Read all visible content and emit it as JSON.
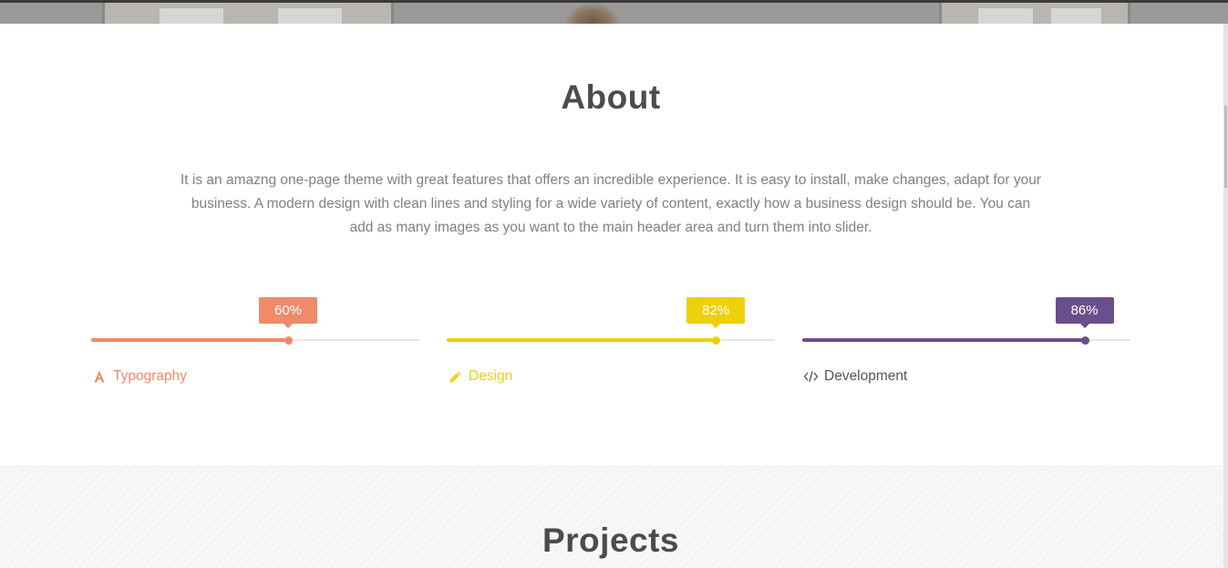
{
  "about": {
    "title": "About",
    "text": "It is an amazng one-page theme with great features that offers an incredible experience. It is easy to install, make changes, adapt for your business. A modern design with clean lines and styling for a wide variety of content, exactly how a business design should be. You can add as many images as you want to the main header area and turn them into slider."
  },
  "skills": [
    {
      "label": "Typography",
      "percent_label": "60%",
      "value": 60,
      "color": "#ef8a6b",
      "icon": "typography-icon"
    },
    {
      "label": "Design",
      "percent_label": "82%",
      "value": 82,
      "color": "#ecd10a",
      "icon": "pencil-icon"
    },
    {
      "label": "Development",
      "percent_label": "86%",
      "value": 86,
      "color": "#6b4e8c",
      "icon": "code-icon"
    }
  ],
  "projects": {
    "title": "Projects"
  }
}
